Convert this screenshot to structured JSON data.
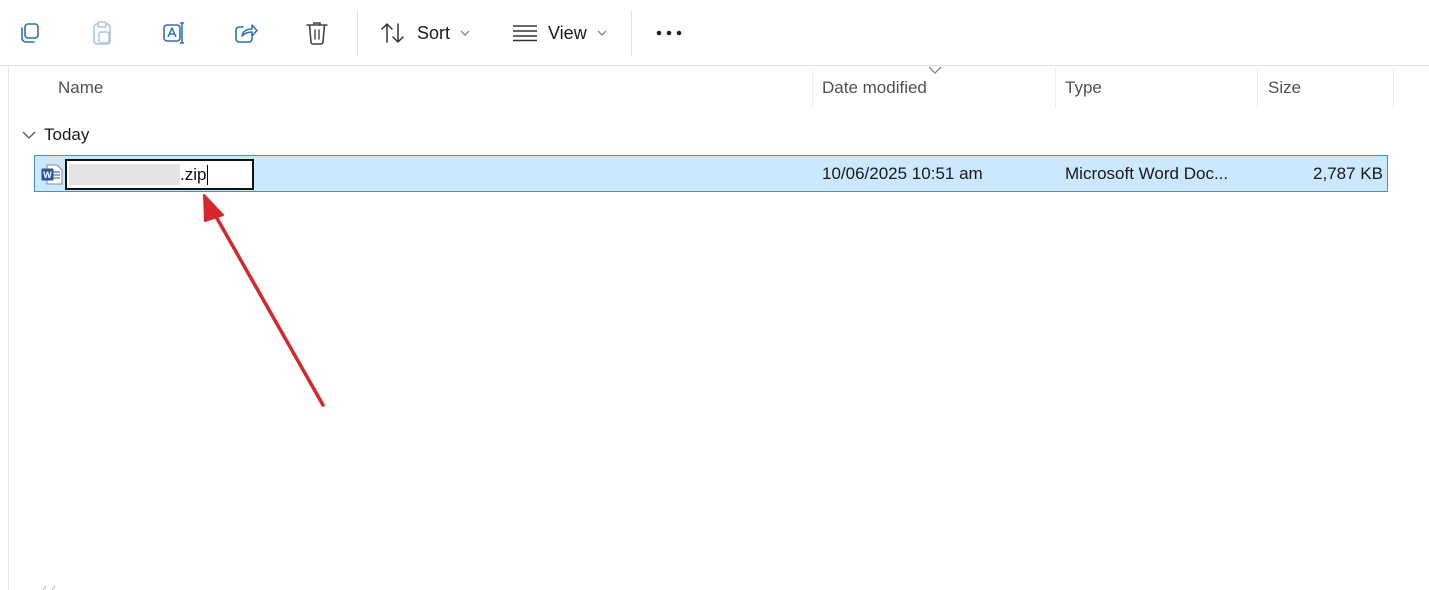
{
  "toolbar": {
    "items": [
      {
        "icon": "copy-icon"
      },
      {
        "icon": "paste-icon",
        "disabled": true
      },
      {
        "icon": "rename-icon"
      },
      {
        "icon": "share-icon"
      },
      {
        "icon": "delete-icon"
      }
    ],
    "sort_label": "Sort",
    "view_label": "View",
    "more_icon": "more-icon"
  },
  "columns": {
    "name": "Name",
    "date_modified": "Date modified",
    "type": "Type",
    "size": "Size"
  },
  "group": {
    "label": "Today"
  },
  "file": {
    "icon": "word-document-icon",
    "name_extension": ".zip",
    "date_modified": "10/06/2025 10:51 am",
    "type": "Microsoft Word Doc...",
    "size": "2,787 KB"
  },
  "colors": {
    "selection_bg": "#cce8ff",
    "selection_border": "#3f8fd2",
    "annotation_arrow": "#d9262b",
    "word_blue": "#2b579a"
  }
}
